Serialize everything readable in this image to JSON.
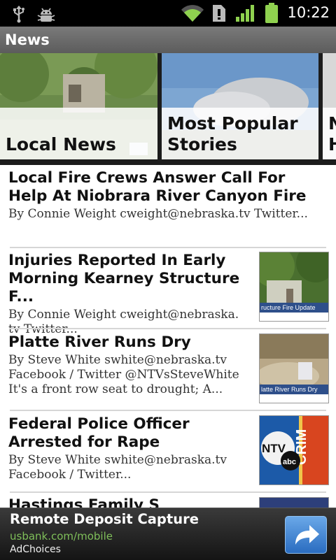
{
  "status_bar": {
    "time": "10:22"
  },
  "action_bar": {
    "title": "News"
  },
  "carousel": {
    "tiles": [
      {
        "label": "Local News"
      },
      {
        "label": "Most Popular Stories"
      },
      {
        "label": "N H"
      }
    ]
  },
  "stories": [
    {
      "headline": "Local Fire Crews Answer Call For Help At Niobrara River Canyon Fire",
      "summary": "By Connie Weight  cweight@nebraska.tv  Twitter..."
    },
    {
      "headline": "Injuries Reported In Early Morning Kearney Structure F...",
      "summary": "By Connie Weight  cweight@nebraska. tv  Twitter...",
      "thumb_caption": "ructure Fire Update"
    },
    {
      "headline": "Platte River Runs Dry",
      "summary": "By Steve White  swhite@nebraska.tv Facebook / Twitter @NTVsSteveWhite It's a front row seat to drought; A...",
      "thumb_caption": "latte River Runs Dry"
    },
    {
      "headline": "Federal Police Officer Arrested for Rape",
      "summary": "By Steve White  swhite@nebraska.tv Facebook / Twitter...",
      "thumb_caption": "CRIM"
    }
  ],
  "ad": {
    "headline": "Remote Deposit Capture",
    "url": "usbank.com/mobile",
    "choices": "AdChoices"
  }
}
